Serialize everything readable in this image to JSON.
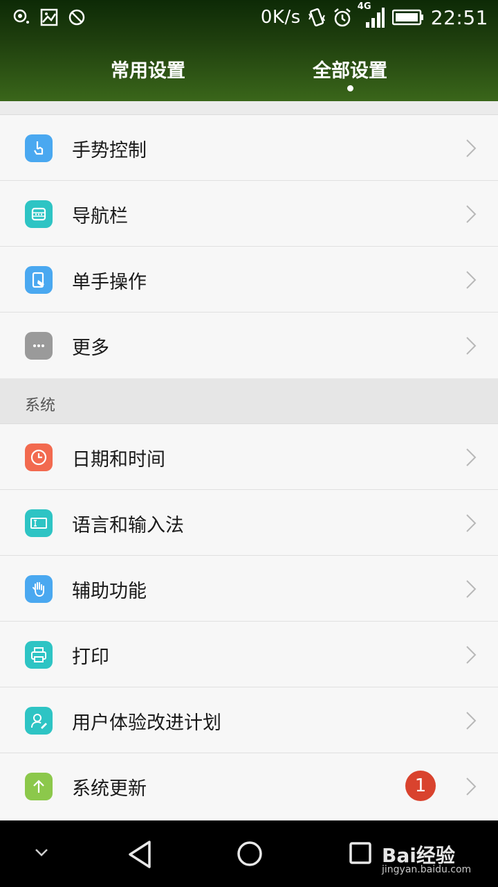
{
  "status_bar": {
    "net_speed": "0K/s",
    "network_type": "4G",
    "time": "22:51",
    "icons_left": [
      "location-icon",
      "image-icon",
      "blocked-icon"
    ],
    "icons_right": [
      "vibrate-icon",
      "alarm-icon",
      "signal-icon",
      "battery-icon"
    ]
  },
  "tabs": [
    {
      "label": "常用设置",
      "active": false
    },
    {
      "label": "全部设置",
      "active": true
    }
  ],
  "rows_top": [
    {
      "label": "手势控制",
      "icon": "gesture-icon",
      "color": "#4aa8f0"
    },
    {
      "label": "导航栏",
      "icon": "navbar-icon",
      "color": "#2ec4c4"
    },
    {
      "label": "单手操作",
      "icon": "one-hand-icon",
      "color": "#4aa8f0"
    },
    {
      "label": "更多",
      "icon": "more-icon",
      "color": "#9a9a9a"
    }
  ],
  "section_system": {
    "title": "系统"
  },
  "rows_system": [
    {
      "label": "日期和时间",
      "icon": "clock-icon",
      "color": "#f26a4f"
    },
    {
      "label": "语言和输入法",
      "icon": "keyboard-icon",
      "color": "#2ec4c4"
    },
    {
      "label": "辅助功能",
      "icon": "hand-icon",
      "color": "#4aa8f0"
    },
    {
      "label": "打印",
      "icon": "printer-icon",
      "color": "#2ec4c4"
    },
    {
      "label": "用户体验改进计划",
      "icon": "user-edit-icon",
      "color": "#2ec4c4"
    },
    {
      "label": "系统更新",
      "icon": "update-arrow-icon",
      "color": "#8cc84b",
      "badge": "1"
    }
  ],
  "watermark": {
    "text": "Bai经验",
    "sub": "jingyan.baidu.com"
  }
}
